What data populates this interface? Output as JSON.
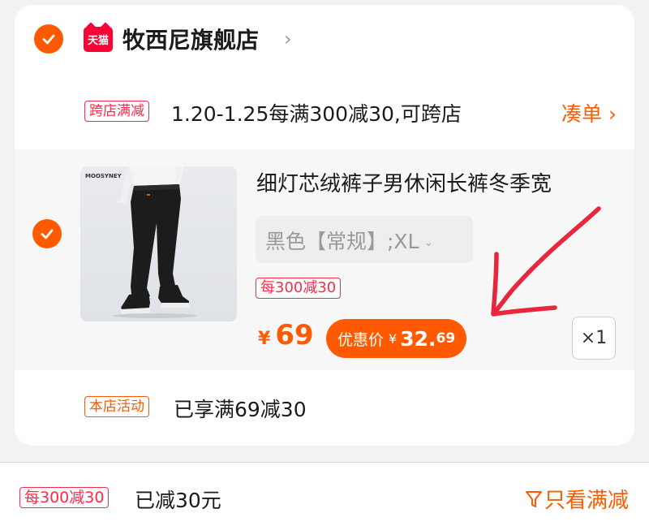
{
  "store": {
    "badge": "天猫",
    "name": "牧西尼旗舰店",
    "chevron": "›"
  },
  "promo": {
    "tag": "跨店满减",
    "text": "1.20-1.25每满300减30,可跨店",
    "link": "凑单 ›"
  },
  "item": {
    "brand_print": "MOOSYNEY",
    "title": "细灯芯绒裤子男休闲长裤冬季宽",
    "sku": "黑色【常规】;XL",
    "sku_chevron": "⌄",
    "promo_tag": "每300减30",
    "price_symbol": "¥",
    "price": "69",
    "discount_label": "优惠价",
    "discount_symbol": "¥",
    "discount_int": "32.",
    "discount_dec": "69",
    "quantity": "×1"
  },
  "activity": {
    "tag": "本店活动",
    "text": "已享满69减30"
  },
  "footer": {
    "tag": "每300减30",
    "text": "已减30元",
    "filter_label": "只看满减"
  },
  "colors": {
    "accent": "#ff5a00",
    "tag_red": "#ff2a4a",
    "annotation": "#e8263c"
  },
  "icons": [
    "check-icon",
    "tmall-logo",
    "chevron-right-icon",
    "chevron-down-icon",
    "filter-icon"
  ]
}
